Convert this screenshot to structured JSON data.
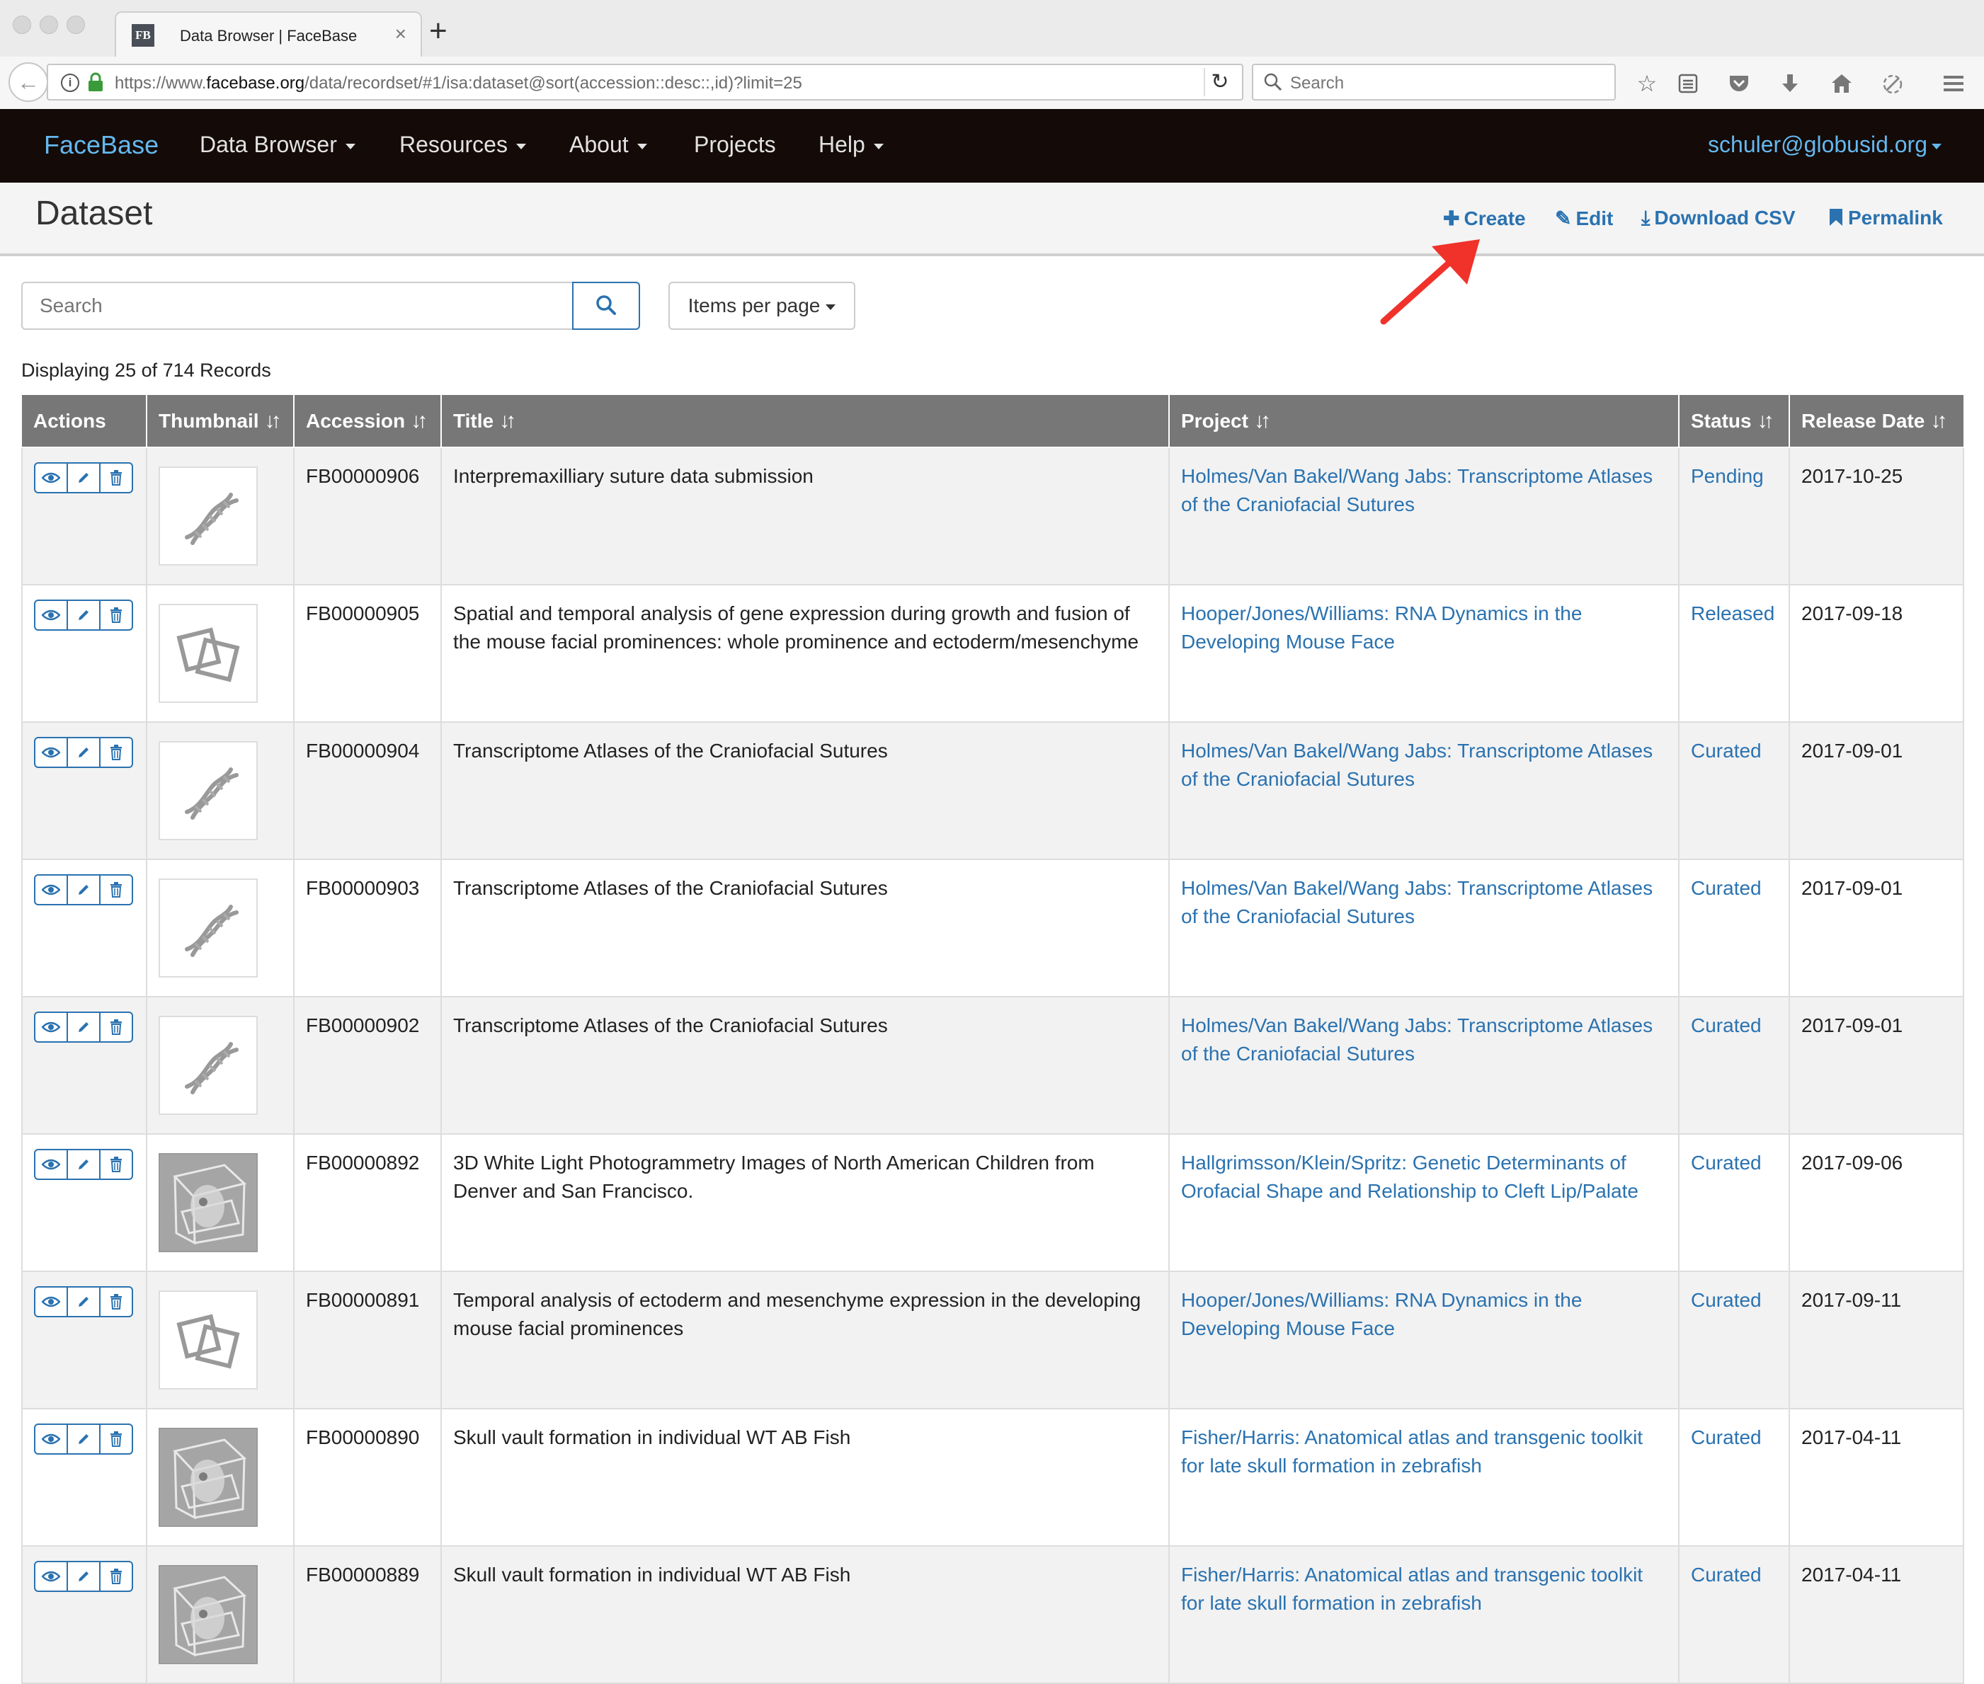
{
  "browser": {
    "tab_title": "Data Browser | FaceBase",
    "tab_favicon": "FB",
    "tab_close": "×",
    "new_tab": "+",
    "url_prefix": "https://www.",
    "url_host": "facebase.org",
    "url_path": "/data/recordset/#1/isa:dataset@sort(accession::desc::,id)?limit=25",
    "search_placeholder": "Search",
    "toolbar_icons": [
      "bookmark-star-icon",
      "reading-list-icon",
      "pocket-icon",
      "download-icon",
      "home-icon",
      "extension-icon",
      "menu-icon"
    ]
  },
  "navbar": {
    "brand": "FaceBase",
    "items": [
      {
        "label": "Data Browser",
        "dropdown": true
      },
      {
        "label": "Resources",
        "dropdown": true
      },
      {
        "label": "About",
        "dropdown": true
      },
      {
        "label": "Projects",
        "dropdown": false
      },
      {
        "label": "Help",
        "dropdown": true
      }
    ],
    "user": "schuler@globusid.org"
  },
  "header": {
    "title": "Dataset",
    "actions": {
      "create": "Create",
      "edit": "Edit",
      "download": "Download CSV",
      "permalink": "Permalink"
    }
  },
  "search": {
    "placeholder": "Search",
    "items_per_page": "Items per page"
  },
  "record_count": "Displaying 25 of 714 Records",
  "table": {
    "columns": [
      "Actions",
      "Thumbnail",
      "Accession",
      "Title",
      "Project",
      "Status",
      "Release Date"
    ],
    "rows": [
      {
        "thumb": "dna",
        "accession": "FB00000906",
        "title": "Interpremaxilliary suture data submission",
        "project": "Holmes/Van Bakel/Wang Jabs: Transcriptome Atlases of the Craniofacial Sutures",
        "status": "Pending",
        "release_date": "2017-10-25"
      },
      {
        "thumb": "squares",
        "accession": "FB00000905",
        "title": "Spatial and temporal analysis of gene expression during growth and fusion of the mouse facial prominences: whole prominence and ectoderm/mesenchyme",
        "project": "Hooper/Jones/Williams: RNA Dynamics in the Developing Mouse Face",
        "status": "Released",
        "release_date": "2017-09-18"
      },
      {
        "thumb": "dna",
        "accession": "FB00000904",
        "title": "Transcriptome Atlases of the Craniofacial Sutures",
        "project": "Holmes/Van Bakel/Wang Jabs: Transcriptome Atlases of the Craniofacial Sutures",
        "status": "Curated",
        "release_date": "2017-09-01"
      },
      {
        "thumb": "dna",
        "accession": "FB00000903",
        "title": "Transcriptome Atlases of the Craniofacial Sutures",
        "project": "Holmes/Van Bakel/Wang Jabs: Transcriptome Atlases of the Craniofacial Sutures",
        "status": "Curated",
        "release_date": "2017-09-01"
      },
      {
        "thumb": "dna",
        "accession": "FB00000902",
        "title": "Transcriptome Atlases of the Craniofacial Sutures",
        "project": "Holmes/Van Bakel/Wang Jabs: Transcriptome Atlases of the Craniofacial Sutures",
        "status": "Curated",
        "release_date": "2017-09-01"
      },
      {
        "thumb": "photo",
        "accession": "FB00000892",
        "title": "3D White Light Photogrammetry Images of North American Children from Denver and San Francisco.",
        "project": "Hallgrimsson/Klein/Spritz: Genetic Determinants of Orofacial Shape and Relationship to Cleft Lip/Palate",
        "status": "Curated",
        "release_date": "2017-09-06"
      },
      {
        "thumb": "squares",
        "accession": "FB00000891",
        "title": "Temporal analysis of ectoderm and mesenchyme expression in the developing mouse facial prominences",
        "project": "Hooper/Jones/Williams: RNA Dynamics in the Developing Mouse Face",
        "status": "Curated",
        "release_date": "2017-09-11"
      },
      {
        "thumb": "photo",
        "accession": "FB00000890",
        "title": "Skull vault formation in individual WT AB Fish",
        "project": "Fisher/Harris: Anatomical atlas and transgenic toolkit for late skull formation in zebrafish",
        "status": "Curated",
        "release_date": "2017-04-11"
      },
      {
        "thumb": "photo",
        "accession": "FB00000889",
        "title": "Skull vault formation in individual WT AB Fish",
        "project": "Fisher/Harris: Anatomical atlas and transgenic toolkit for late skull formation in zebrafish",
        "status": "Curated",
        "release_date": "2017-04-11"
      }
    ]
  },
  "colors": {
    "navbar_bg": "#140a07",
    "brand": "#63b8ef",
    "link": "#2a72b0",
    "table_header": "#777777",
    "arrow": "#f0322a"
  }
}
